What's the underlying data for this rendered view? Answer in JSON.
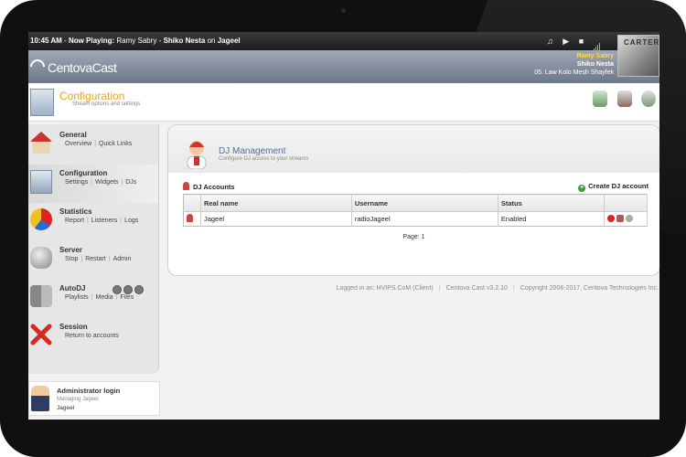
{
  "topbar": {
    "time": "10:45 AM",
    "now_playing_label": "Now Playing:",
    "artist": "Ramy Sabry",
    "separator": "-",
    "title": "Shiko Nesta",
    "on": "on",
    "station": "Jageel"
  },
  "album_art": {
    "text": "CARTER"
  },
  "header": {
    "logo": "CentovaCast",
    "track_artist": "Ramy Sabry",
    "track_title": "Shiko Nesta",
    "track_song": "05. Law Kolo Mesh Shayfek"
  },
  "config": {
    "title": "Configuration",
    "subtitle": "Stream options and settings"
  },
  "sidebar": {
    "items": [
      {
        "title": "General",
        "links": [
          "Overview",
          "Quick Links"
        ]
      },
      {
        "title": "Configuration",
        "links": [
          "Settings",
          "Widgets",
          "DJs"
        ]
      },
      {
        "title": "Statistics",
        "links": [
          "Report",
          "Listeners",
          "Logs"
        ]
      },
      {
        "title": "Server",
        "links": [
          "Stop",
          "Restart",
          "Admin"
        ]
      },
      {
        "title": "AutoDJ",
        "links": [
          "Playlists",
          "Media",
          "Files"
        ]
      },
      {
        "title": "Session",
        "links": [
          "Return to accounts"
        ]
      }
    ]
  },
  "login": {
    "title": "Administrator login",
    "managing": "Managing Jageel",
    "user": "Jageel"
  },
  "panel": {
    "title": "DJ Management",
    "subtitle": "Configure DJ access to your streams",
    "section": "DJ Accounts",
    "create": "Create DJ account",
    "columns": [
      "Real name",
      "Username",
      "Status"
    ],
    "rows": [
      {
        "real_name": "Jageel",
        "username": "radioJageel",
        "status": "Enabled"
      }
    ],
    "pager": "Page: 1"
  },
  "footer": {
    "logged": "Logged in as: HVIPS.CoM (Client)",
    "version": "Centova Cast v3.2.10",
    "copyright": "Copyright 2006-2017, Centova Technologies Inc."
  }
}
